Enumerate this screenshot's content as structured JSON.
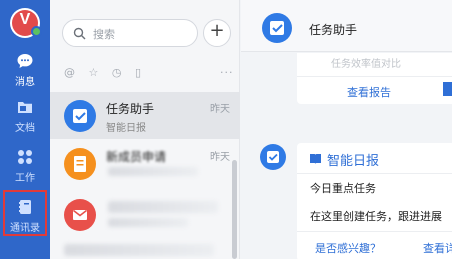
{
  "sidebar": {
    "items": [
      {
        "label": "消息",
        "icon": "chat-bubble-icon"
      },
      {
        "label": "文档",
        "icon": "folder-icon"
      },
      {
        "label": "工作",
        "icon": "grid-apps-icon"
      },
      {
        "label": "通讯录",
        "icon": "contacts-book-icon"
      }
    ],
    "highlight_color": "#e03a3a",
    "background_color": "#2f67c9"
  },
  "list": {
    "search_placeholder": "搜索",
    "add_label": "+",
    "filters": [
      "@",
      "☆",
      "◷",
      "▯"
    ],
    "more_label": "···",
    "conversations": [
      {
        "title": "任务助手",
        "subtitle": "智能日报",
        "time": "昨天",
        "avatar_color": "#2f7ae5",
        "icon": "task-check-icon"
      },
      {
        "title": "新成员申请",
        "subtitle": "",
        "time": "昨天",
        "avatar_color": "#f5901e",
        "icon": "document-icon"
      },
      {
        "title": "",
        "subtitle": "",
        "time": "",
        "avatar_color": "#e8504a",
        "icon": "mail-icon"
      }
    ]
  },
  "chat": {
    "title": "任务助手",
    "card1": {
      "faded_text": "任务效率值对比",
      "link": "查看报告"
    },
    "card2": {
      "title": "智能日报",
      "line1": "今日重点任务",
      "line2": "在这里创建任务，跟进进展",
      "action_left": "是否感兴趣？",
      "action_right": "查看详"
    }
  }
}
